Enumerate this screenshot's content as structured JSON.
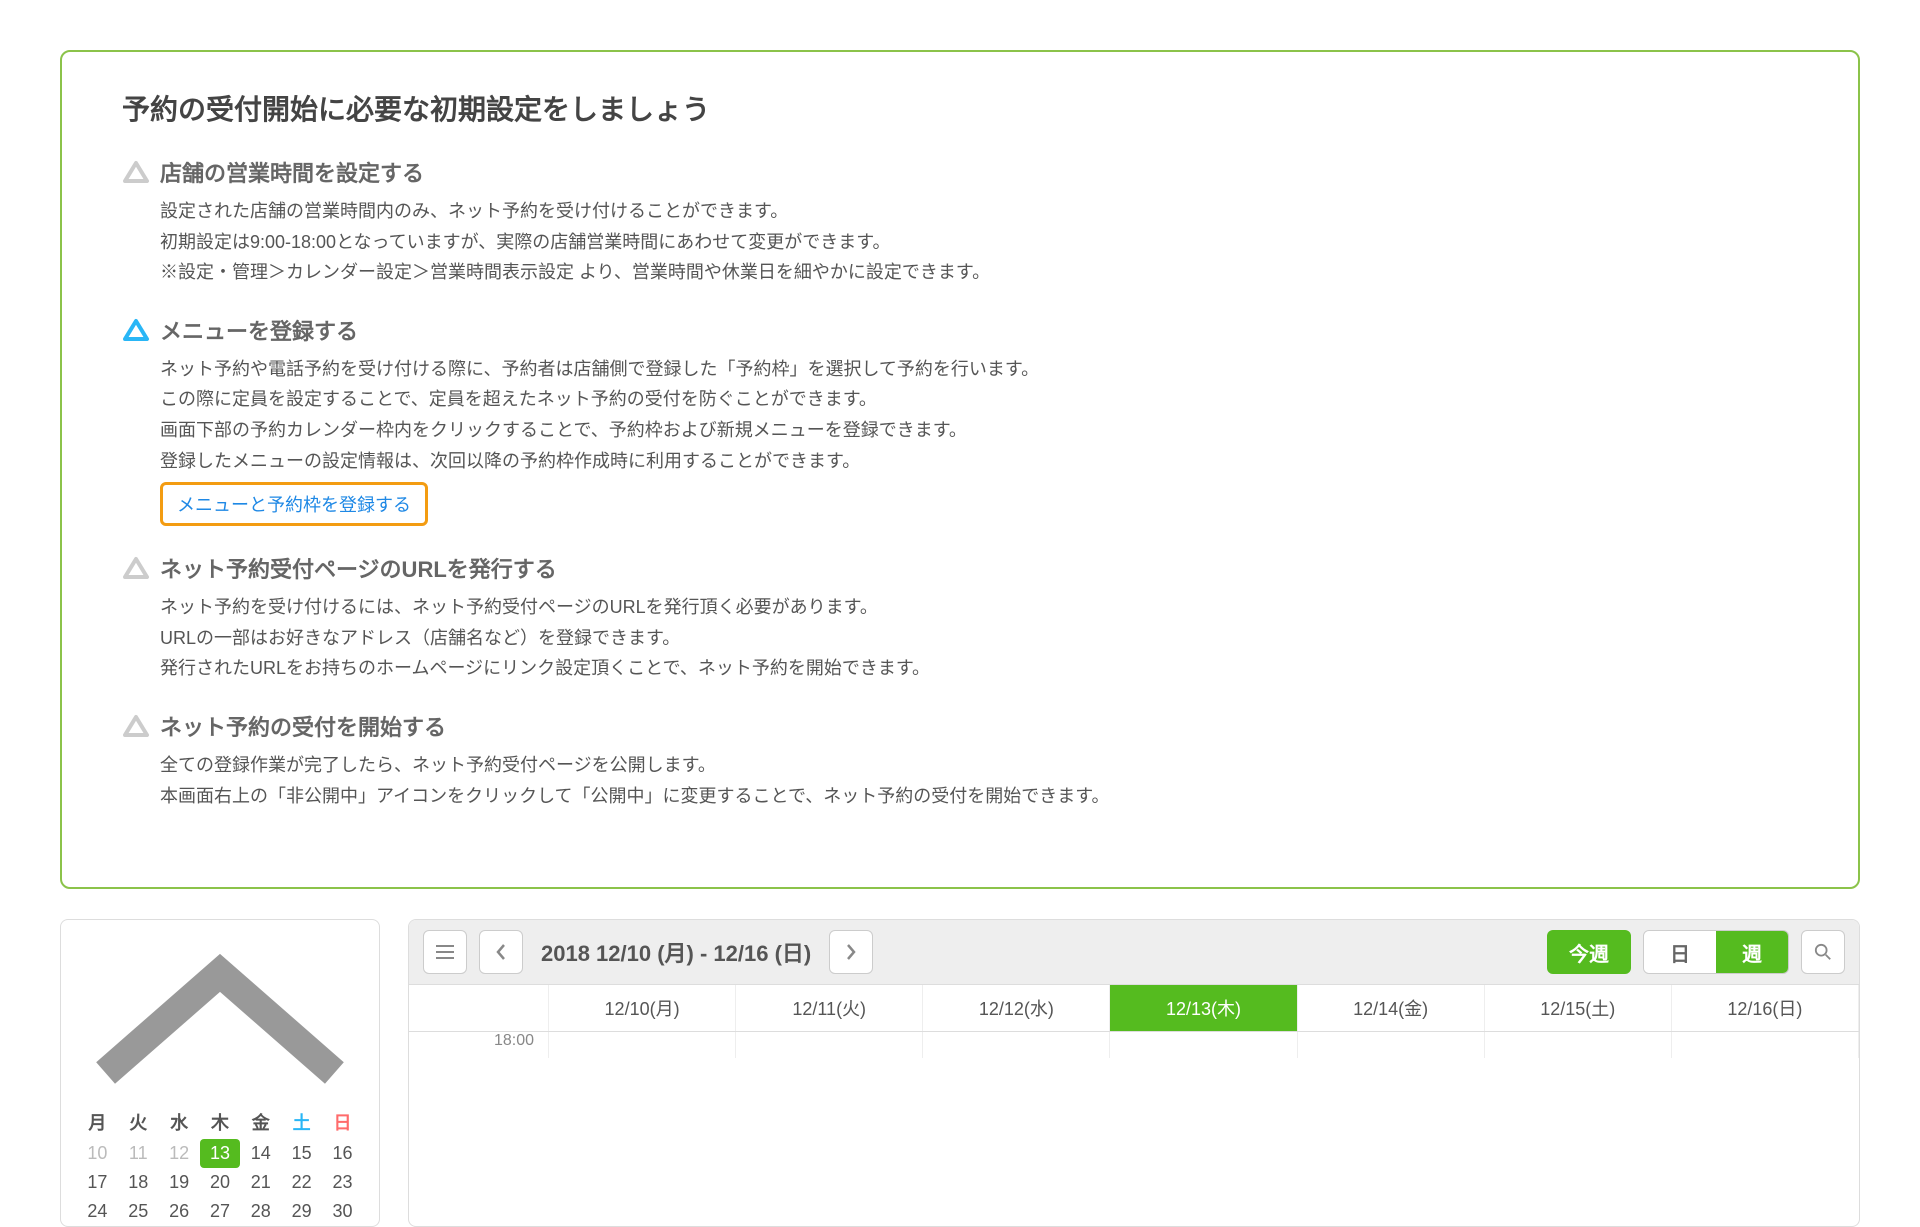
{
  "setup": {
    "title": "予約の受付開始に必要な初期設定をしましょう",
    "steps": [
      {
        "status": "incomplete",
        "heading": "店舗の営業時間を設定する",
        "lines": [
          "設定された店舗の営業時間内のみ、ネット予約を受け付けることができます。",
          "初期設定は9:00-18:00となっていますが、実際の店舗営業時間にあわせて変更ができます。",
          "※設定・管理＞カレンダー設定＞営業時間表示設定 より、営業時間や休業日を細やかに設定できます。"
        ]
      },
      {
        "status": "active",
        "heading": "メニューを登録する",
        "lines": [
          "ネット予約や電話予約を受け付ける際に、予約者は店舗側で登録した「予約枠」を選択して予約を行います。",
          "この際に定員を設定することで、定員を超えたネット予約の受付を防ぐことができます。",
          "画面下部の予約カレンダー枠内をクリックすることで、予約枠および新規メニューを登録できます。",
          "登録したメニューの設定情報は、次回以降の予約枠作成時に利用することができます。"
        ],
        "link_label": "メニューと予約枠を登録する"
      },
      {
        "status": "incomplete",
        "heading": "ネット予約受付ページのURLを発行する",
        "lines": [
          "ネット予約を受け付けるには、ネット予約受付ページのURLを発行頂く必要があります。",
          "URLの一部はお好きなアドレス（店舗名など）を登録できます。",
          "発行されたURLをお持ちのホームページにリンク設定頂くことで、ネット予約を開始できます。"
        ]
      },
      {
        "status": "incomplete",
        "heading": "ネット予約の受付を開始する",
        "lines": [
          "全ての登録作業が完了したら、ネット予約受付ページを公開します。",
          "本画面右上の「非公開中」アイコンをクリックして「公開中」に変更することで、ネット予約の受付を開始できます。"
        ]
      }
    ]
  },
  "mini_calendar": {
    "dow": [
      "月",
      "火",
      "水",
      "木",
      "金",
      "土",
      "日"
    ],
    "rows": [
      [
        10,
        11,
        12,
        13,
        14,
        15,
        16
      ],
      [
        17,
        18,
        19,
        20,
        21,
        22,
        23
      ],
      [
        24,
        25,
        26,
        27,
        28,
        29,
        30
      ]
    ],
    "today": 13,
    "dim_range_end": 12
  },
  "schedule": {
    "range_label": "2018 12/10 (月) - 12/16 (日)",
    "this_week_label": "今週",
    "view_day_label": "日",
    "view_week_label": "週",
    "active_view": "week",
    "days": [
      "12/10(月)",
      "12/11(火)",
      "12/12(水)",
      "12/13(木)",
      "12/14(金)",
      "12/15(土)",
      "12/16(日)"
    ],
    "today_index": 3,
    "first_time_row": "18:00"
  }
}
